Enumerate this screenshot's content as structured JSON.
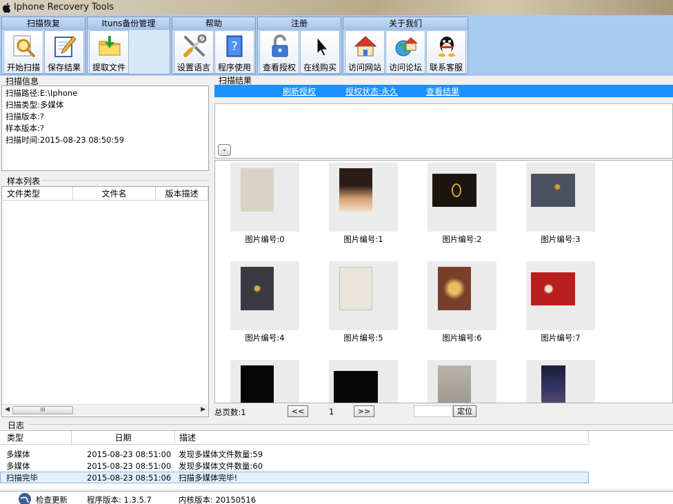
{
  "window": {
    "title": "Iphone Recovery Tools"
  },
  "toolbar": {
    "groups": [
      {
        "title": "扫描恢复",
        "buttons": [
          {
            "label": "开始扫描",
            "icon": "magnifier-icon"
          },
          {
            "label": "保存结果",
            "icon": "notepad-pencil-icon"
          }
        ]
      },
      {
        "title": "Ituns备份管理",
        "buttons": [
          {
            "label": "提取文件",
            "icon": "folder-import-icon"
          }
        ]
      },
      {
        "title": "帮助",
        "buttons": [
          {
            "label": "设置语言",
            "icon": "tools-icon"
          },
          {
            "label": "程序使用",
            "icon": "help-book-icon"
          }
        ]
      },
      {
        "title": "注册",
        "buttons": [
          {
            "label": "查看授权",
            "icon": "padlock-icon"
          },
          {
            "label": "在线购买",
            "icon": "cursor-icon"
          }
        ]
      },
      {
        "title": "关于我们",
        "buttons": [
          {
            "label": "访问网站",
            "icon": "home-icon"
          },
          {
            "label": "访问论坛",
            "icon": "globe-house-icon"
          },
          {
            "label": "联系客服",
            "icon": "qq-penguin-icon"
          }
        ]
      }
    ]
  },
  "scan_info": {
    "title": "扫描信息",
    "lines": [
      "扫描路径:E:\\Iphone",
      "扫描类型:多媒体",
      "扫描版本:?",
      "样本版本:?",
      "扫描时间:2015-08-23 08:50:59"
    ]
  },
  "sample_list": {
    "title": "样本列表",
    "columns": [
      "文件类型",
      "文件名",
      "版本描述"
    ],
    "scroll_thumb": "III"
  },
  "results": {
    "title": "扫描结果",
    "links": [
      "刷新授权",
      "授权状态:永久",
      "查看结果"
    ],
    "collapse_symbol": "⌄",
    "thumbnails": [
      {
        "label": "图片编号:0",
        "color": "#d9d4c8"
      },
      {
        "label": "图片编号:1",
        "color": "#3a2b22"
      },
      {
        "label": "图片编号:2",
        "color": "#1b1510"
      },
      {
        "label": "图片编号:3",
        "color": "#4a5060"
      },
      {
        "label": "图片编号:4",
        "color": "#3b3a42"
      },
      {
        "label": "图片编号:5",
        "color": "#e9e4dc"
      },
      {
        "label": "图片编号:6",
        "color": "#7a3f2a"
      },
      {
        "label": "图片编号:7",
        "color": "#b8201e"
      },
      {
        "label": "",
        "color": "#050505"
      },
      {
        "label": "",
        "color": "#080808"
      },
      {
        "label": "",
        "color": "#a9a59c"
      },
      {
        "label": "",
        "color": "#2a2b48"
      }
    ]
  },
  "pager": {
    "total_label": "总页数:1",
    "prev": "<<",
    "page": "1",
    "next": ">>",
    "locate": "定位"
  },
  "log": {
    "title": "日志",
    "columns": [
      "类型",
      "日期",
      "描述"
    ],
    "rows": [
      {
        "type": "多媒体",
        "date": "2015-08-23 08:51:00",
        "desc": "发现多媒体文件数量:59"
      },
      {
        "type": "多媒体",
        "date": "2015-08-23 08:51:00",
        "desc": "发现多媒体文件数量:60"
      },
      {
        "type": "扫描完毕",
        "date": "2015-08-23 08:51:06",
        "desc": "扫描多媒体完毕!"
      }
    ]
  },
  "status": {
    "update": "检查更新",
    "program_version": "程序版本: 1.3.5.7",
    "kernel_version": "内核版本: 20150516"
  }
}
